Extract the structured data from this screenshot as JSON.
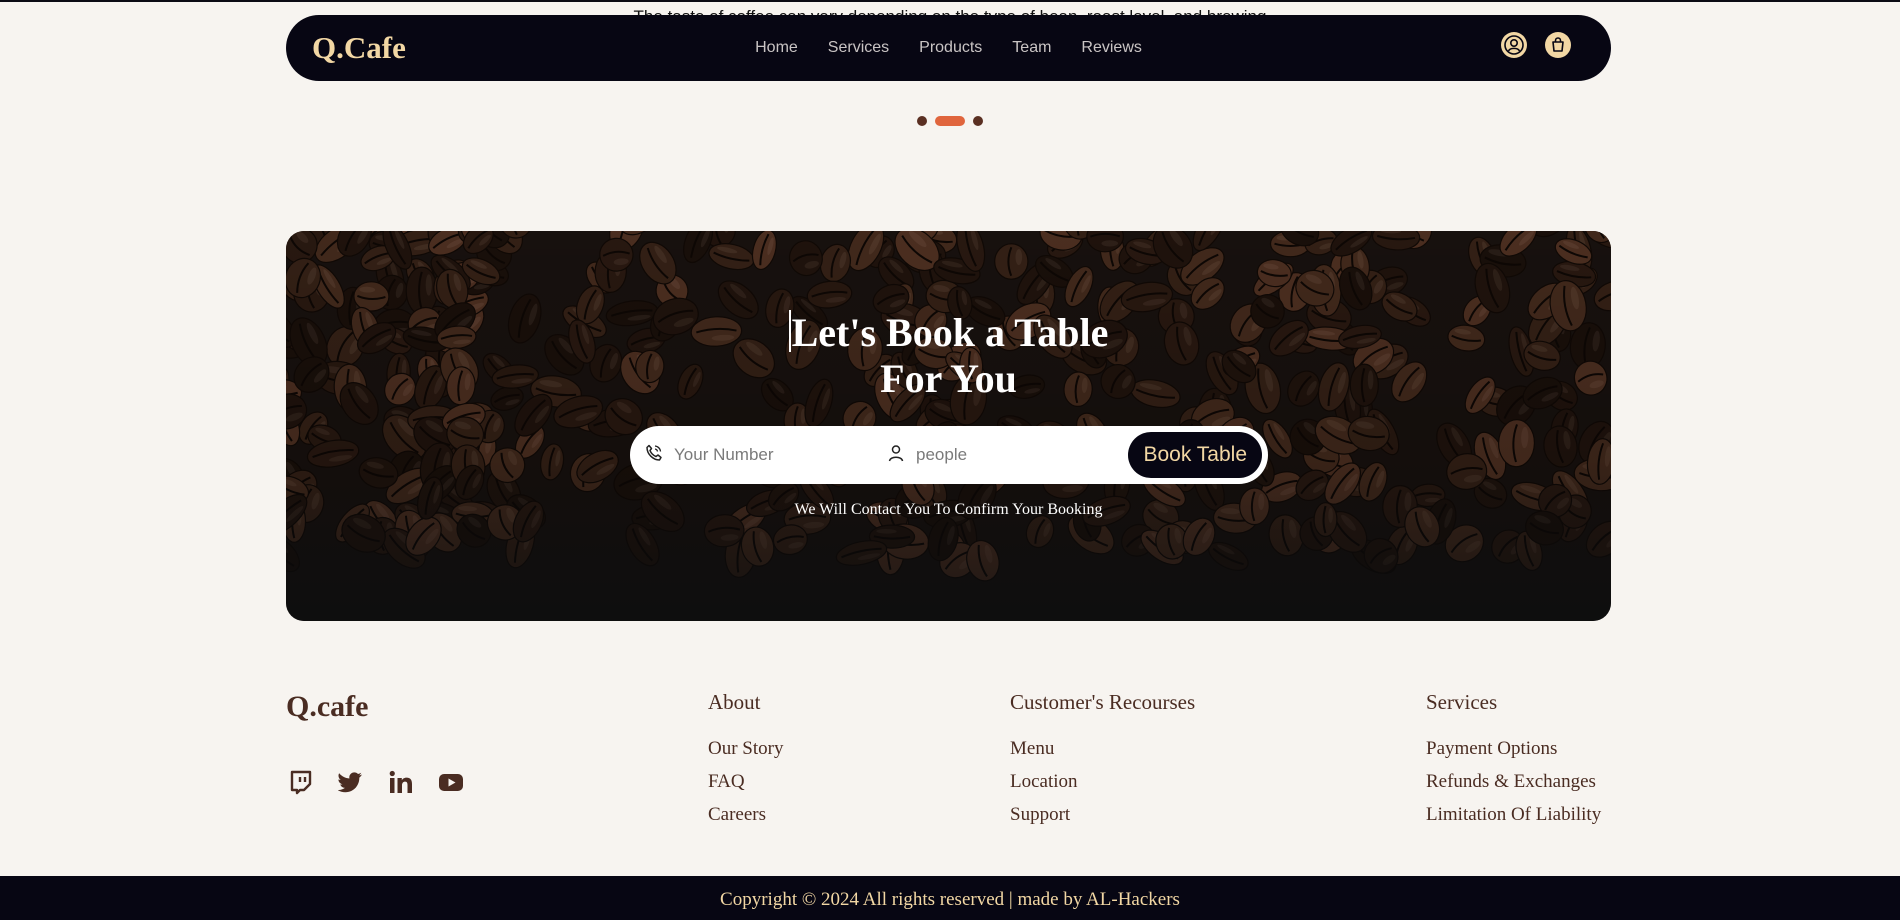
{
  "peek": {
    "text": "The taste of coffee can vary depending on the type of bean, roast level, and brewing"
  },
  "navbar": {
    "logo": "Q.Cafe",
    "links": [
      "Home",
      "Services",
      "Products",
      "Team",
      "Reviews"
    ],
    "icons": [
      "user-icon",
      "shopping-bag-icon"
    ]
  },
  "carousel": {
    "slides": 3,
    "active_index": 1,
    "active_color": "#e0653d"
  },
  "booking": {
    "title_line1": "Let's Book a Table",
    "title_line2": "For You",
    "phone_placeholder": "Your Number",
    "people_placeholder": "people",
    "button": "Book Table",
    "note": "We Will Contact You To Confirm Your Booking"
  },
  "footer": {
    "brand": "Q.cafe",
    "socials": [
      "twitch-icon",
      "twitter-icon",
      "linkedin-icon",
      "youtube-icon"
    ],
    "columns": [
      {
        "heading": "About",
        "links": [
          "Our Story",
          "FAQ",
          "Careers"
        ]
      },
      {
        "heading": "Customer's Recourses",
        "links": [
          "Menu",
          "Location",
          "Support"
        ]
      },
      {
        "heading": "Services",
        "links": [
          "Payment Options",
          "Refunds & Exchanges",
          "Limitation Of Liability"
        ]
      }
    ],
    "copyright": "Copyright © 2024 All rights reserved | made by AL-Hackers"
  },
  "colors": {
    "dark": "#070613",
    "gold": "#f2d7a4",
    "brown": "#4a2c22",
    "background": "#f7f4f0"
  }
}
